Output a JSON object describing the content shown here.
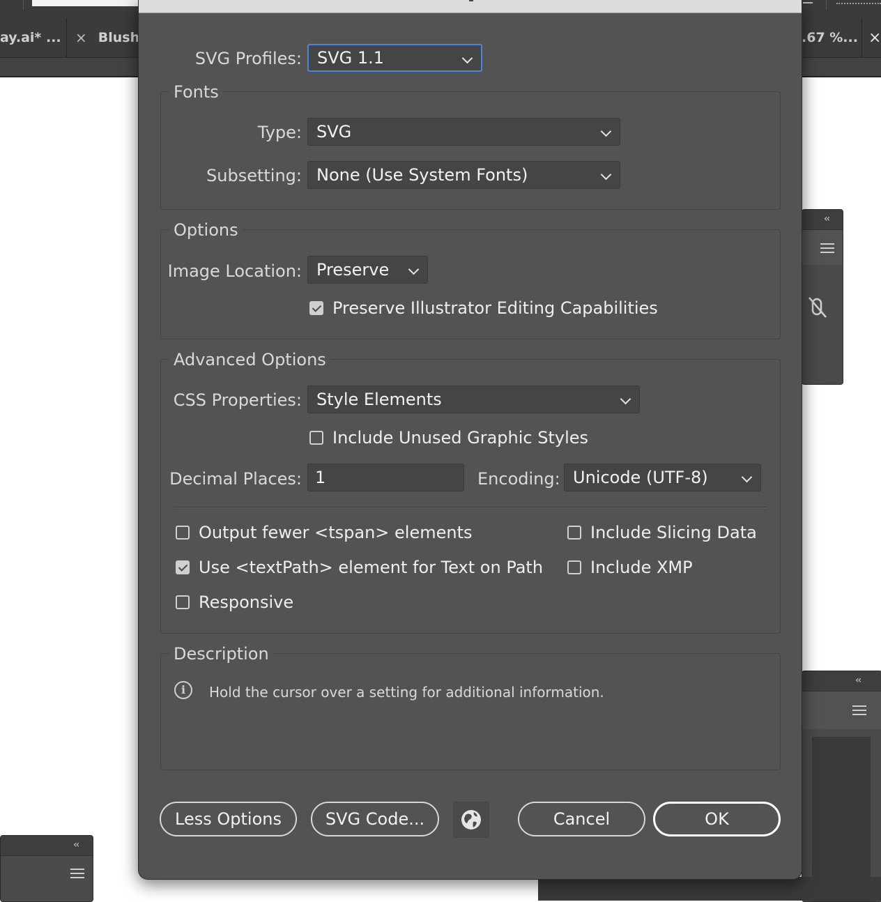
{
  "background": {
    "tabs": [
      {
        "label": "ay.ai* ..."
      },
      {
        "close": "×",
        "label": "Blush"
      },
      {
        "label": ".67 %...",
        "close": "×"
      }
    ],
    "panel_collapse": "‹‹"
  },
  "dialog": {
    "svg_profiles": {
      "label": "SVG Profiles:",
      "value": "SVG 1.1"
    },
    "fonts": {
      "title": "Fonts",
      "type": {
        "label": "Type:",
        "value": "SVG"
      },
      "subsetting": {
        "label": "Subsetting:",
        "value": "None (Use System Fonts)"
      }
    },
    "options": {
      "title": "Options",
      "image_location": {
        "label": "Image Location:",
        "value": "Preserve"
      },
      "preserve_editing": {
        "label": "Preserve Illustrator Editing Capabilities",
        "checked": true
      }
    },
    "advanced": {
      "title": "Advanced Options",
      "css_properties": {
        "label": "CSS Properties:",
        "value": "Style Elements"
      },
      "include_unused": {
        "label": "Include Unused Graphic Styles",
        "checked": false
      },
      "decimal_places": {
        "label": "Decimal Places:",
        "value": "1"
      },
      "encoding": {
        "label": "Encoding:",
        "value": "Unicode (UTF-8)"
      },
      "output_fewer_tspan": {
        "label": "Output fewer <tspan> elements",
        "checked": false
      },
      "use_textpath": {
        "label": "Use <textPath> element for Text on Path",
        "checked": true
      },
      "responsive": {
        "label": "Responsive",
        "checked": false
      },
      "include_slicing": {
        "label": "Include Slicing Data",
        "checked": false
      },
      "include_xmp": {
        "label": "Include XMP",
        "checked": false
      }
    },
    "description": {
      "title": "Description",
      "info_glyph": "i",
      "text": "Hold the cursor over a setting for additional information."
    },
    "buttons": {
      "less_options": "Less Options",
      "svg_code": "SVG Code...",
      "cancel": "Cancel",
      "ok": "OK"
    }
  }
}
